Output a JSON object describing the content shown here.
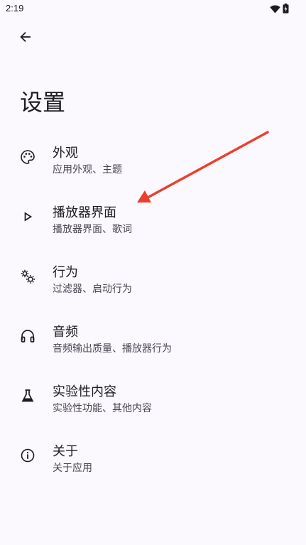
{
  "status_bar": {
    "time": "2:19",
    "icons": [
      "wifi-icon",
      "battery-icon"
    ]
  },
  "header": {
    "back_icon": "arrow-back-icon",
    "title": "设置"
  },
  "settings": [
    {
      "id": "appearance",
      "icon": "palette-icon",
      "title": "外观",
      "subtitle": "应用外观、主题"
    },
    {
      "id": "player-ui",
      "icon": "play-icon",
      "title": "播放器界面",
      "subtitle": "播放器界面、歌词"
    },
    {
      "id": "behavior",
      "icon": "gears-icon",
      "title": "行为",
      "subtitle": "过滤器、启动行为"
    },
    {
      "id": "audio",
      "icon": "headphones-icon",
      "title": "音频",
      "subtitle": "音频输出质量、播放器行为"
    },
    {
      "id": "experimental",
      "icon": "flask-icon",
      "title": "实验性内容",
      "subtitle": "实验性功能、其他内容"
    },
    {
      "id": "about",
      "icon": "info-icon",
      "title": "关于",
      "subtitle": "关于应用"
    }
  ],
  "colors": {
    "background": "#fbf8fe",
    "text_primary": "#1c1b1f",
    "text_secondary": "#47464f",
    "annotation": "#e8412f"
  }
}
